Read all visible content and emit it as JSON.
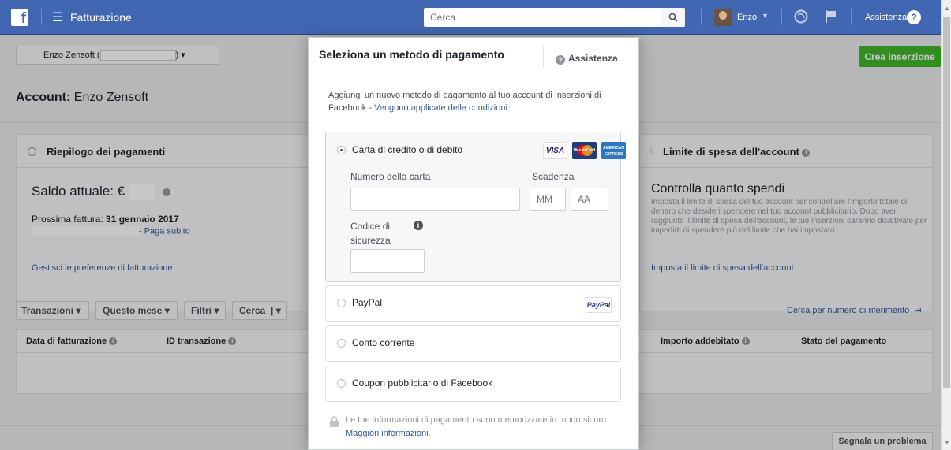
{
  "topbar": {
    "app_title": "Fatturazione",
    "search_placeholder": "Cerca",
    "user_name": "Enzo",
    "help_label": "Assistenza"
  },
  "account_selector": {
    "label_prefix": "Enzo Zensoft (",
    "label_suffix": ")"
  },
  "create_ad_button": "Crea inserzione",
  "account_heading": {
    "label": "Account:",
    "name": "Enzo Zensoft"
  },
  "summary": {
    "title": "Riepilogo dei pagamenti",
    "balance_label": "Saldo attuale: €",
    "next_invoice_label": "Prossima fattura:",
    "next_invoice_date": "31 gennaio 2017",
    "pay_now": "- Paga subito",
    "manage_link": "Gestisci le preferenze di fatturazione"
  },
  "limit": {
    "title": "Limite di spesa dell'account",
    "heading": "Controlla quanto spendi",
    "description": "Imposta il limite di spesa del tuo account per controllare l'importo totale di denaro che desideri spendere nel tuo account pubblicitario. Dopo aver raggiunto il limite di spesa dell'account, le tue inserzioni saranno disattivate per impedirti di spendere più del limite che hai impostato.",
    "link": "Imposta il limite di spesa dell'account"
  },
  "filters": {
    "transactions": "Transazioni",
    "this_month": "Questo mese",
    "filters": "Filtri",
    "search": "Cerca",
    "search_ref": "Cerca per numero di riferimento"
  },
  "table": {
    "headers": [
      "Data di fatturazione",
      "ID transazione",
      "Importo addebitato",
      "Stato del pagamento"
    ]
  },
  "report_button": "Segnala un problema",
  "modal": {
    "title": "Seleziona un metodo di pagamento",
    "help": "Assistenza",
    "intro": "Aggiungi un nuovo metodo di pagamento al tuo account di Inserzioni di Facebook - ",
    "intro_link": "Vengono applicate delle condizioni",
    "options": [
      {
        "label": "Carta di credito o di debito",
        "selected": true
      },
      {
        "label": "PayPal",
        "selected": false
      },
      {
        "label": "Conto corrente",
        "selected": false
      },
      {
        "label": "Coupon pubblicitario di Facebook",
        "selected": false
      }
    ],
    "card_form": {
      "number_label": "Numero della carta",
      "expiry_label": "Scadenza",
      "month_placeholder": "MM",
      "year_placeholder": "AA",
      "cvv_label_1": "Codice di",
      "cvv_label_2": "sicurezza"
    },
    "card_logos": {
      "visa": "VISA",
      "mastercard": "MasterCard",
      "amex": "AMERICAN EXPRESS"
    },
    "paypal_logo": "PayPal",
    "secure_text": "Le tue informazioni di pagamento sono memorizzate in modo sicuro.",
    "secure_link": "Maggiori informazioni."
  },
  "colors": {
    "fb_blue": "#4267b2",
    "green": "#42b72a",
    "link": "#365899"
  }
}
